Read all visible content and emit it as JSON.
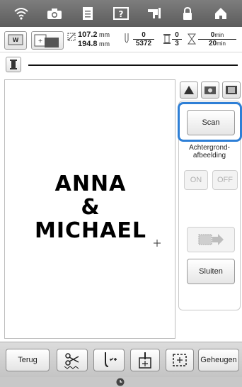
{
  "topbar": {
    "icons": [
      "wifi-icon",
      "camera-icon",
      "document-icon",
      "help-icon",
      "sewing-machine-icon",
      "lock-icon",
      "home-icon"
    ]
  },
  "info": {
    "size_w": "107.2",
    "size_h": "194.8",
    "size_unit": "mm",
    "stitch_num": "0",
    "stitch_den": "5372",
    "color_num": "0",
    "color_den": "3",
    "time_num": "0",
    "time_den": "20",
    "time_unit": "min"
  },
  "canvas": {
    "line1": "ANNA",
    "line2": "&",
    "line3": "MICHAEL"
  },
  "panel": {
    "scan_label": "Scan",
    "bg_label_line1": "Achtergrond-",
    "bg_label_line2": "afbeelding",
    "on_label": "ON",
    "off_label": "OFF",
    "sluiten_label": "Sluiten"
  },
  "bottom": {
    "back_label": "Terug",
    "memory_label": "Geheugen"
  },
  "colors": {
    "highlight": "#2e7fd6",
    "topbar": "#6b6b6b"
  }
}
